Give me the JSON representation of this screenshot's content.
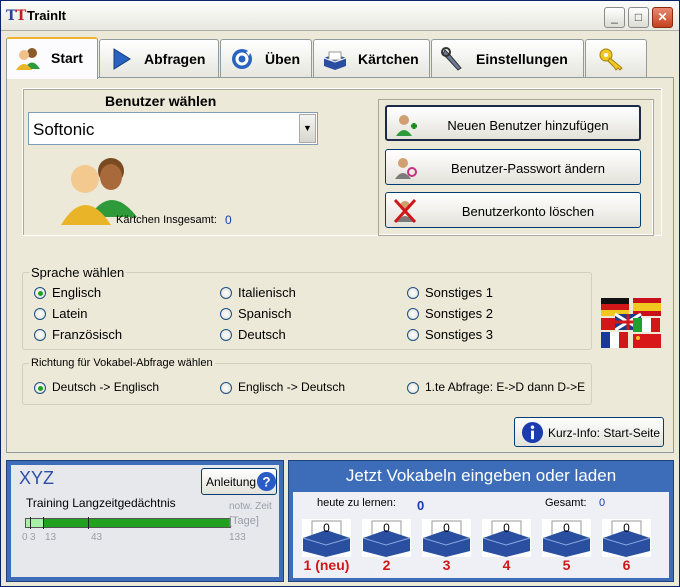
{
  "window": {
    "title": "TrainIt"
  },
  "tabs": [
    {
      "label": "Start",
      "icon": "users-icon"
    },
    {
      "label": "Abfragen",
      "icon": "play-icon"
    },
    {
      "label": "Üben",
      "icon": "refresh-icon"
    },
    {
      "label": "Kärtchen",
      "icon": "card-box-icon"
    },
    {
      "label": "Einstellungen",
      "icon": "wrench-icon"
    },
    {
      "label": "",
      "icon": "key-icon"
    }
  ],
  "user": {
    "heading": "Benutzer wählen",
    "selected": "Softonic",
    "cards_total_label": "Kärtchen Insgesamt:",
    "cards_total_value": "0",
    "add_button": "Neuen Benutzer hinzufügen",
    "password_button": "Benutzer-Passwort ändern",
    "delete_button": "Benutzerkonto löschen"
  },
  "language": {
    "title": "Sprache wählen",
    "options": [
      "Englisch",
      "Italienisch",
      "Sonstiges 1",
      "Latein",
      "Spanisch",
      "Sonstiges 2",
      "Französisch",
      "Deutsch",
      "Sonstiges 3"
    ],
    "selected": "Englisch"
  },
  "direction": {
    "title": "Richtung für Vokabel-Abfrage wählen",
    "options": [
      "Deutsch -> Englisch",
      "Englisch -> Deutsch",
      "1.te Abfrage: E->D dann D->E"
    ],
    "selected": "Deutsch -> Englisch"
  },
  "info_button": "Kurz-Info: Start-Seite",
  "training": {
    "name": "XYZ",
    "help_button": "Anleitung",
    "subtitle": "Training Langzeitgedächtnis",
    "hint": "notw. Zeit",
    "unit": "[Tage]",
    "ticks": [
      "0",
      "3",
      "13",
      "43",
      "133"
    ],
    "progress_fraction": 0
  },
  "vocab": {
    "title": "Jetzt Vokabeln eingeben oder laden",
    "today_label": "heute zu lernen:",
    "today_value": "0",
    "total_label": "Gesamt:",
    "total_value": "0",
    "boxes": [
      {
        "count": "0",
        "label": "1 (neu)"
      },
      {
        "count": "0",
        "label": "2"
      },
      {
        "count": "0",
        "label": "3"
      },
      {
        "count": "0",
        "label": "4"
      },
      {
        "count": "0",
        "label": "5"
      },
      {
        "count": "0",
        "label": "6"
      }
    ]
  },
  "colors": {
    "accent_blue": "#3d6db8",
    "box_number_red": "#d01818",
    "progress_green": "#22a020"
  }
}
